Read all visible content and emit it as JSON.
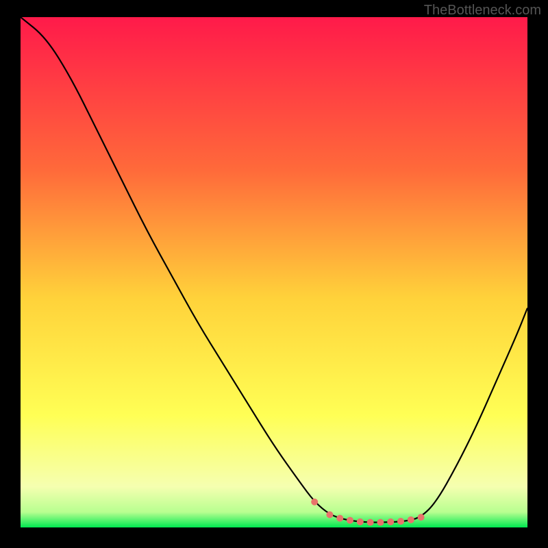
{
  "watermark": "TheBottleneck.com",
  "chart_data": {
    "type": "line",
    "title": "",
    "xlabel": "",
    "ylabel": "",
    "xlim": [
      0,
      100
    ],
    "ylim": [
      0,
      100
    ],
    "gradient_stops": [
      {
        "offset": 0,
        "color": "#ff1a4a"
      },
      {
        "offset": 30,
        "color": "#ff6a3a"
      },
      {
        "offset": 55,
        "color": "#ffd23a"
      },
      {
        "offset": 78,
        "color": "#ffff55"
      },
      {
        "offset": 92,
        "color": "#f5ffb0"
      },
      {
        "offset": 97,
        "color": "#b8ff90"
      },
      {
        "offset": 100,
        "color": "#00e850"
      }
    ],
    "curve": [
      {
        "x": 0,
        "y": 100
      },
      {
        "x": 5,
        "y": 96
      },
      {
        "x": 10,
        "y": 88
      },
      {
        "x": 15,
        "y": 78
      },
      {
        "x": 20,
        "y": 68
      },
      {
        "x": 25,
        "y": 58
      },
      {
        "x": 30,
        "y": 49
      },
      {
        "x": 35,
        "y": 40
      },
      {
        "x": 40,
        "y": 32
      },
      {
        "x": 45,
        "y": 24
      },
      {
        "x": 50,
        "y": 16
      },
      {
        "x": 55,
        "y": 9
      },
      {
        "x": 58,
        "y": 5
      },
      {
        "x": 61,
        "y": 2.5
      },
      {
        "x": 64,
        "y": 1.5
      },
      {
        "x": 68,
        "y": 1
      },
      {
        "x": 72,
        "y": 1
      },
      {
        "x": 76,
        "y": 1.2
      },
      {
        "x": 79,
        "y": 2
      },
      {
        "x": 82,
        "y": 5
      },
      {
        "x": 86,
        "y": 12
      },
      {
        "x": 90,
        "y": 20
      },
      {
        "x": 94,
        "y": 29
      },
      {
        "x": 98,
        "y": 38
      },
      {
        "x": 100,
        "y": 43
      }
    ],
    "markers": [
      {
        "x": 58,
        "y": 5
      },
      {
        "x": 61,
        "y": 2.5
      },
      {
        "x": 63,
        "y": 1.8
      },
      {
        "x": 65,
        "y": 1.4
      },
      {
        "x": 67,
        "y": 1.1
      },
      {
        "x": 69,
        "y": 1
      },
      {
        "x": 71,
        "y": 1
      },
      {
        "x": 73,
        "y": 1.1
      },
      {
        "x": 75,
        "y": 1.2
      },
      {
        "x": 77,
        "y": 1.5
      },
      {
        "x": 79,
        "y": 2
      }
    ],
    "marker_color": "#e8736b",
    "marker_radius": 5
  }
}
